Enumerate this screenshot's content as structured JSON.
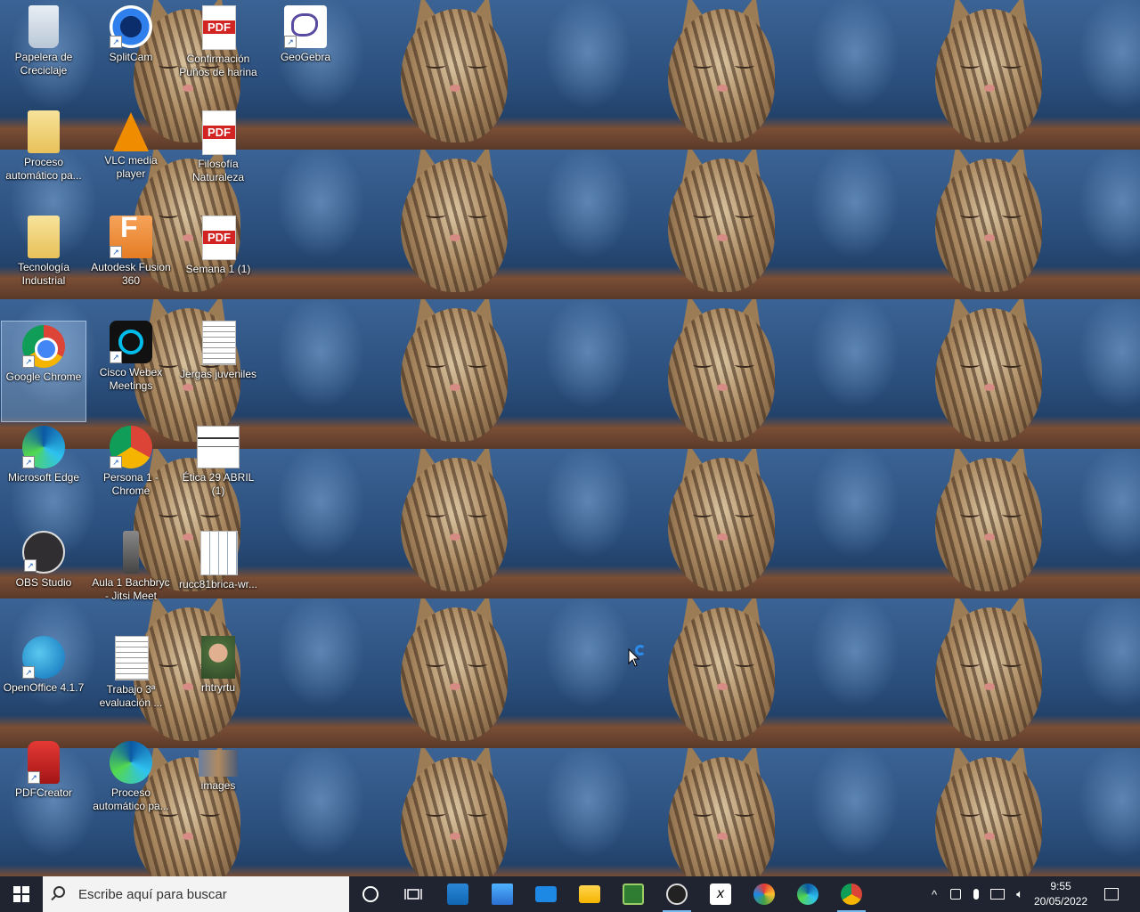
{
  "desktop": {
    "icons": [
      {
        "label": "Papelera de Creciclaje",
        "icon": "recycle-bin-icon"
      },
      {
        "label": "SplitCam",
        "icon": "splitcam-icon"
      },
      {
        "label": "Confirmación Puños de harina",
        "icon": "pdf-icon"
      },
      {
        "label": "GeoGebra",
        "icon": "geogebra-icon"
      },
      {
        "label": "Proceso automático pa...",
        "icon": "folder-icon"
      },
      {
        "label": "VLC media player",
        "icon": "vlc-icon"
      },
      {
        "label": "Filosofía Naturaleza",
        "icon": "pdf-icon"
      },
      {
        "label": "Tecnología Industrial",
        "icon": "folder-icon"
      },
      {
        "label": "Autodesk Fusion 360",
        "icon": "fusion360-icon"
      },
      {
        "label": "Semana 1 (1)",
        "icon": "pdf-icon"
      },
      {
        "label": "Google Chrome",
        "icon": "chrome-icon"
      },
      {
        "label": "Cisco Webex Meetings",
        "icon": "webex-icon"
      },
      {
        "label": "Jergas juveniles",
        "icon": "document-icon"
      },
      {
        "label": "Microsoft Edge",
        "icon": "edge-icon"
      },
      {
        "label": "Persona 1 - Chrome",
        "icon": "chrome-profile-icon"
      },
      {
        "label": "Ética 29 ABRIL (1)",
        "icon": "document-icon"
      },
      {
        "label": "OBS Studio",
        "icon": "obs-icon"
      },
      {
        "label": "Aula 1 Bachbryc - Jitsi Meet",
        "icon": "jitsi-icon"
      },
      {
        "label": "rucc81brica-wr...",
        "icon": "spreadsheet-icon"
      },
      {
        "label": "OpenOffice 4.1.7",
        "icon": "openoffice-icon"
      },
      {
        "label": "Trabajo 3ª evaluación ...",
        "icon": "document-icon"
      },
      {
        "label": "rhtryrtu",
        "icon": "photo-icon"
      },
      {
        "label": "PDFCreator",
        "icon": "pdfcreator-icon"
      },
      {
        "label": "Proceso automático pa...",
        "icon": "edge-icon"
      },
      {
        "label": "images",
        "icon": "image-icon"
      }
    ]
  },
  "taskbar": {
    "search_placeholder": "Escribe aquí para buscar",
    "clock_time": "9:55",
    "clock_date": "20/05/2022",
    "apps": [
      "cortana-icon",
      "task-view-icon",
      "store-icon",
      "computer-icon",
      "mail-icon",
      "file-explorer-icon",
      "camera-app-icon",
      "obs-icon",
      "geogebra-icon",
      "paint-icon",
      "edge-icon",
      "chrome-icon"
    ]
  },
  "colors": {
    "taskbar_bg": "#1f2430",
    "search_bg": "#f3f3f3",
    "accent": "#76b9ed"
  }
}
